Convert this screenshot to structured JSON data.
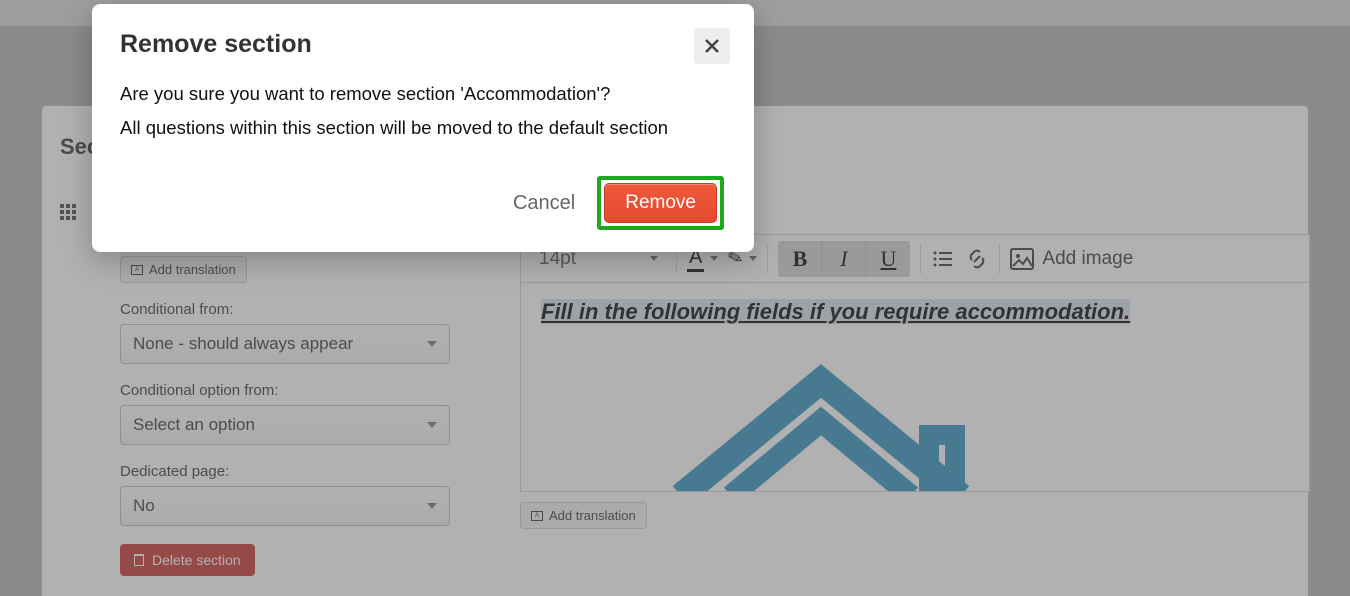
{
  "modal": {
    "title": "Remove section",
    "line1": "Are you sure you want to remove section 'Accommodation'?",
    "line2": "All questions within this section will be moved to the default section",
    "cancel": "Cancel",
    "remove": "Remove"
  },
  "panel": {
    "section_label_truncated": "Sec",
    "add_translation": "Add translation",
    "conditional_from_label": "Conditional from:",
    "conditional_from_value": "None - should always appear",
    "conditional_option_label": "Conditional option from:",
    "conditional_option_value": "Select an option",
    "dedicated_page_label": "Dedicated page:",
    "dedicated_page_value": "No",
    "delete_section": "Delete section"
  },
  "toolbar": {
    "font_size": "14pt",
    "bold": "B",
    "italic": "I",
    "underline": "U",
    "add_image": "Add image"
  },
  "editor": {
    "text": "Fill in the following fields if you require accommodation.",
    "add_translation": "Add translation"
  }
}
